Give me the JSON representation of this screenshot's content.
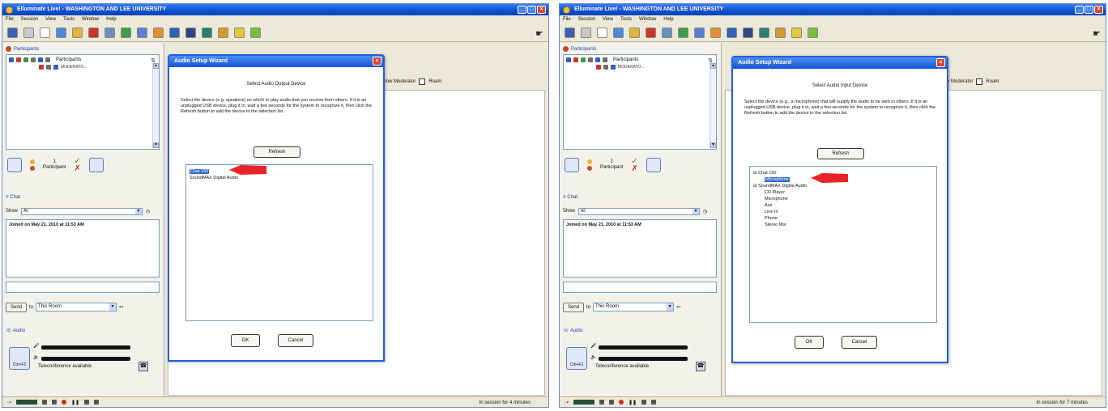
{
  "left": {
    "app_title": "Elluminate Live! - WASHINGTON AND LEE UNIVERSITY",
    "menus": [
      "File",
      "Session",
      "View",
      "Tools",
      "Window",
      "Help"
    ],
    "participants_heading": "Participants",
    "participants_col": "Participants",
    "participant_name": "MODERATO...",
    "participant_count": "1",
    "participant_label": "Participant",
    "chat_heading": "Chat",
    "show_label": "Show",
    "show_value": "All",
    "chat_message": "Joined on May 21, 2010 at 11:53 AM",
    "send_label": "Send",
    "to_label": "to",
    "room_value": "This Room",
    "audio_heading": "Audio",
    "talk_label": "Ctrl+F2",
    "teleconference": "Teleconference available",
    "follow_label": "Follow Moderator",
    "roam_label": "Roam",
    "session_status": "In session for 4 minutes",
    "dialog": {
      "title": "Audio Setup Wizard",
      "heading": "Select Audio Output Device",
      "description": "Select the device (e.g. speakers) on which to play audio that you receive from others. If it is an unplugged USB device, plug it in, wait a few seconds for the system to recognize it, then click the Refresh button to add the device to the selection list.",
      "refresh": "Refresh",
      "devices": [
        "Chat 150",
        "SoundMAX Digital Audio"
      ],
      "ok": "OK",
      "cancel": "Cancel"
    }
  },
  "right": {
    "app_title": "Elluminate Live! - WASHINGTON AND LEE UNIVERSITY",
    "menus": [
      "File",
      "Session",
      "View",
      "Tools",
      "Window",
      "Help"
    ],
    "participants_heading": "Participants",
    "participants_col": "Participants",
    "participant_name": "MODERATO...",
    "participant_count": "1",
    "participant_label": "Participant",
    "chat_heading": "Chat",
    "show_label": "Show",
    "show_value": "All",
    "chat_message": "Joined on May 21, 2010 at 11:53 AM",
    "send_label": "Send",
    "to_label": "to",
    "room_value": "This Room",
    "audio_heading": "Audio",
    "talk_label": "Ctrl+F2",
    "teleconference": "Teleconference available",
    "follow_label": "Follow Moderator",
    "roam_label": "Roam",
    "session_status": "In session for 7 minutes",
    "dialog": {
      "title": "Audio Setup Wizard",
      "heading": "Select Audio Input Device",
      "description": "Select the device (e.g., a microphone) that will supply the audio to be sent to others. If it is an unplugged USB device, plug it in, wait a few seconds for the system to recognize it, then click the Refresh button to add the device to the selection list.",
      "refresh": "Refresh",
      "tree": [
        {
          "label": "Chat 150",
          "children": [
            "Microphone"
          ]
        },
        {
          "label": "SoundMAX Digital Audio",
          "children": [
            "CD Player",
            "Microphone",
            "Aux",
            "Line In",
            "Phone",
            "Stereo Mix"
          ]
        }
      ],
      "ok": "OK",
      "cancel": "Cancel"
    }
  },
  "colors": {
    "titlebar": "#0b4fd0",
    "selection": "#316ac5",
    "arrow": "#e8242a"
  },
  "icons": {
    "menu_icon": "app-logo-icon",
    "minimize": "minimize-icon",
    "maximize": "maximize-icon",
    "close": "close-icon"
  }
}
